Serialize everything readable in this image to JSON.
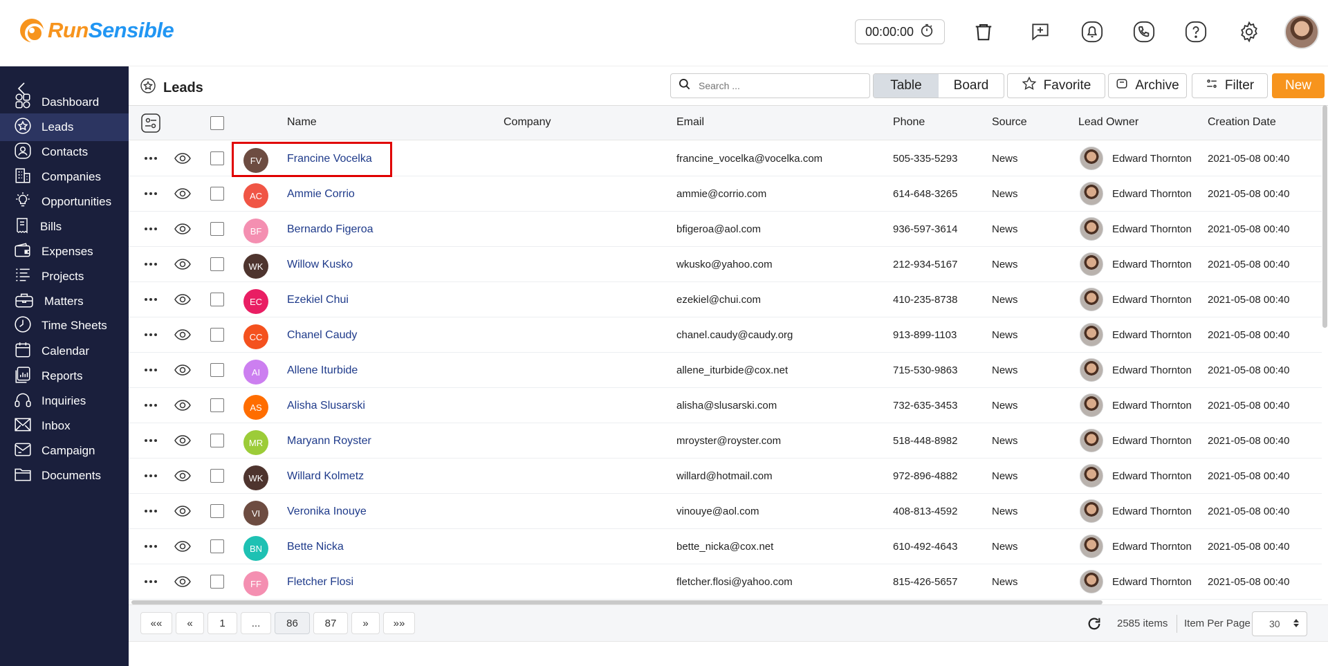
{
  "brand": {
    "part1": "Run",
    "part2": "Sensible"
  },
  "topbar": {
    "timer": "00:00:00",
    "icons": [
      "stopwatch-icon",
      "trash-icon",
      "add-task-icon",
      "bell-icon",
      "phone-icon",
      "help-icon",
      "gear-icon"
    ]
  },
  "sidebar": {
    "items": [
      {
        "label": "Dashboard",
        "icon": "dashboard-icon"
      },
      {
        "label": "Leads",
        "icon": "star-icon"
      },
      {
        "label": "Contacts",
        "icon": "contact-icon"
      },
      {
        "label": "Companies",
        "icon": "building-icon"
      },
      {
        "label": "Opportunities",
        "icon": "lightbulb-icon"
      },
      {
        "label": "Bills",
        "icon": "receipt-icon"
      },
      {
        "label": "Expenses",
        "icon": "wallet-icon"
      },
      {
        "label": "Projects",
        "icon": "list-icon"
      },
      {
        "label": "Matters",
        "icon": "briefcase-icon"
      },
      {
        "label": "Time Sheets",
        "icon": "clock-icon"
      },
      {
        "label": "Calendar",
        "icon": "calendar-icon"
      },
      {
        "label": "Reports",
        "icon": "report-icon"
      },
      {
        "label": "Inquiries",
        "icon": "headset-icon"
      },
      {
        "label": "Inbox",
        "icon": "mail-icon"
      },
      {
        "label": "Campaign",
        "icon": "campaign-icon"
      },
      {
        "label": "Documents",
        "icon": "folder-icon"
      }
    ],
    "active_index": 1
  },
  "header": {
    "title": "Leads",
    "search_placeholder": "Search ...",
    "view_table": "Table",
    "view_board": "Board",
    "favorite": "Favorite",
    "archive": "Archive",
    "filter": "Filter",
    "new": "New"
  },
  "table": {
    "columns": [
      "Name",
      "Company",
      "Email",
      "Phone",
      "Source",
      "Lead Owner",
      "Creation Date"
    ],
    "rows": [
      {
        "initials": "FV",
        "color": "#6d4c41",
        "name": "Francine Vocelka",
        "company": "",
        "email": "francine_vocelka@vocelka.com",
        "phone": "505-335-5293",
        "source": "News",
        "owner": "Edward Thornton",
        "date": "2021-05-08 00:40"
      },
      {
        "initials": "AC",
        "color": "#f05545",
        "name": "Ammie Corrio",
        "company": "",
        "email": "ammie@corrio.com",
        "phone": "614-648-3265",
        "source": "News",
        "owner": "Edward Thornton",
        "date": "2021-05-08 00:40"
      },
      {
        "initials": "BF",
        "color": "#f48fb1",
        "name": "Bernardo Figeroa",
        "company": "",
        "email": "bfigeroa@aol.com",
        "phone": "936-597-3614",
        "source": "News",
        "owner": "Edward Thornton",
        "date": "2021-05-08 00:40"
      },
      {
        "initials": "WK",
        "color": "#4e342e",
        "name": "Willow Kusko",
        "company": "",
        "email": "wkusko@yahoo.com",
        "phone": "212-934-5167",
        "source": "News",
        "owner": "Edward Thornton",
        "date": "2021-05-08 00:40"
      },
      {
        "initials": "EC",
        "color": "#e91e63",
        "name": "Ezekiel Chui",
        "company": "",
        "email": "ezekiel@chui.com",
        "phone": "410-235-8738",
        "source": "News",
        "owner": "Edward Thornton",
        "date": "2021-05-08 00:40"
      },
      {
        "initials": "CC",
        "color": "#f4511e",
        "name": "Chanel Caudy",
        "company": "",
        "email": "chanel.caudy@caudy.org",
        "phone": "913-899-1103",
        "source": "News",
        "owner": "Edward Thornton",
        "date": "2021-05-08 00:40"
      },
      {
        "initials": "AI",
        "color": "#cc7ff0",
        "name": "Allene Iturbide",
        "company": "",
        "email": "allene_iturbide@cox.net",
        "phone": "715-530-9863",
        "source": "News",
        "owner": "Edward Thornton",
        "date": "2021-05-08 00:40"
      },
      {
        "initials": "AS",
        "color": "#ff6d00",
        "name": "Alisha Slusarski",
        "company": "",
        "email": "alisha@slusarski.com",
        "phone": "732-635-3453",
        "source": "News",
        "owner": "Edward Thornton",
        "date": "2021-05-08 00:40"
      },
      {
        "initials": "MR",
        "color": "#9ccc38",
        "name": "Maryann Royster",
        "company": "",
        "email": "mroyster@royster.com",
        "phone": "518-448-8982",
        "source": "News",
        "owner": "Edward Thornton",
        "date": "2021-05-08 00:40"
      },
      {
        "initials": "WK",
        "color": "#4e342e",
        "name": "Willard Kolmetz",
        "company": "",
        "email": "willard@hotmail.com",
        "phone": "972-896-4882",
        "source": "News",
        "owner": "Edward Thornton",
        "date": "2021-05-08 00:40"
      },
      {
        "initials": "VI",
        "color": "#6d4c41",
        "name": "Veronika Inouye",
        "company": "",
        "email": "vinouye@aol.com",
        "phone": "408-813-4592",
        "source": "News",
        "owner": "Edward Thornton",
        "date": "2021-05-08 00:40"
      },
      {
        "initials": "BN",
        "color": "#1ec1b3",
        "name": "Bette Nicka",
        "company": "",
        "email": "bette_nicka@cox.net",
        "phone": "610-492-4643",
        "source": "News",
        "owner": "Edward Thornton",
        "date": "2021-05-08 00:40"
      },
      {
        "initials": "FF",
        "color": "#f48fb1",
        "name": "Fletcher Flosi",
        "company": "",
        "email": "fletcher.flosi@yahoo.com",
        "phone": "815-426-5657",
        "source": "News",
        "owner": "Edward Thornton",
        "date": "2021-05-08 00:40"
      }
    ]
  },
  "pagination": {
    "first": "««",
    "prev": "«",
    "pages": [
      "1",
      "...",
      "86",
      "87"
    ],
    "current": "86",
    "next": "»",
    "last": "»»",
    "total_items": "2585 items",
    "per_page_label": "Item Per Page",
    "per_page_value": "30"
  }
}
